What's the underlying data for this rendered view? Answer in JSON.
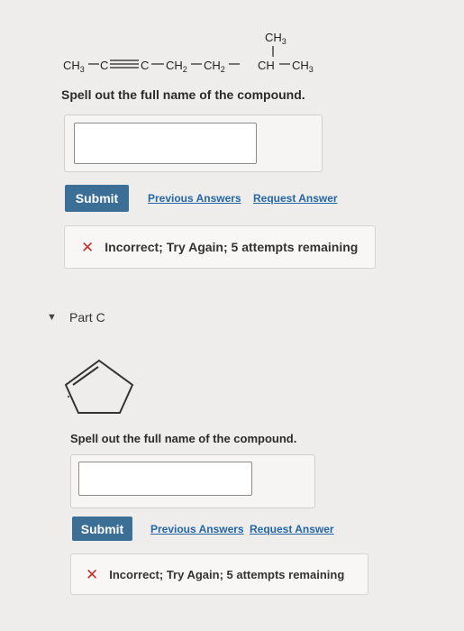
{
  "part_b": {
    "formula": {
      "main_prefix": "CH",
      "main_sub": "3",
      "segment_c1": "C",
      "segment_c2": "C",
      "segment_ch2_a": "CH",
      "segment_ch2_a_sub": "2",
      "segment_ch2_b": "CH",
      "segment_ch2_b_sub": "2",
      "segment_ch": "CH",
      "segment_end": "CH",
      "segment_end_sub": "3",
      "branch": "CH",
      "branch_sub": "3"
    },
    "prompt": "Spell out the full name of the compound.",
    "answer_value": "",
    "submit_label": "Submit",
    "previous_answers_label": "Previous Answers",
    "request_answer_label": "Request Answer",
    "feedback_icon": "x-icon",
    "feedback_text": "Incorrect; Try Again; 5 attempts remaining"
  },
  "part_c": {
    "title": "Part C",
    "structure": "cyclopentene",
    "prompt": "Spell out the full name of the compound.",
    "answer_value": "",
    "submit_label": "Submit",
    "previous_answers_label": "Previous Answers",
    "request_answer_label": "Request Answer",
    "feedback_icon": "x-icon",
    "feedback_text": "Incorrect; Try Again; 5 attempts remaining"
  },
  "colors": {
    "background": "#eeedeb",
    "submit_button": "#3b6f95",
    "link": "#2466a6",
    "error_icon": "#c4302b"
  }
}
